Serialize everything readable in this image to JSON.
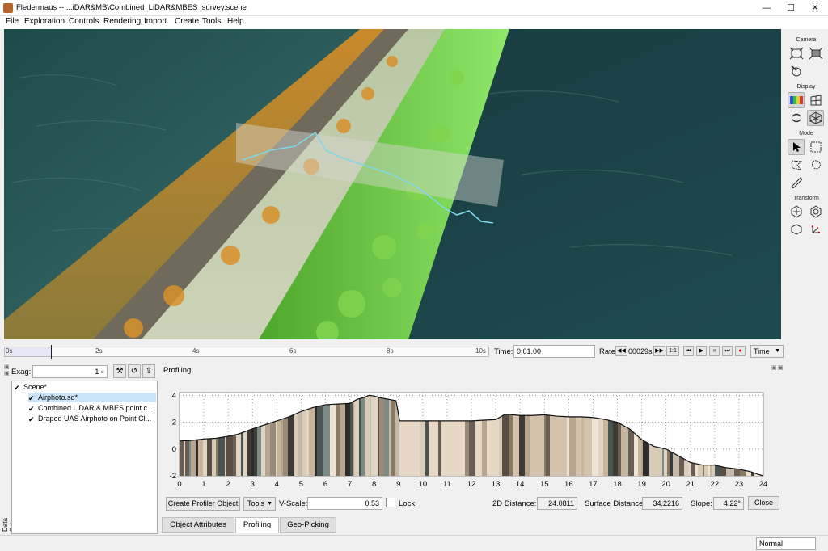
{
  "window": {
    "title": "Fledermaus -- ...iDAR&MB\\Combined_LiDAR&MBES_survey.scene",
    "minimize": "—",
    "maximize": "☐",
    "close": "✕"
  },
  "menu": [
    "File",
    "Exploration",
    "Controls",
    "Rendering",
    "Import",
    "Create",
    "Tools",
    "Help"
  ],
  "toolbar": {
    "camera_header": "Camera",
    "display_header": "Display",
    "mode_header": "Mode",
    "transform_header": "Transform"
  },
  "timeline": {
    "ticks": [
      "0s",
      "2s",
      "4s",
      "6s",
      "8s",
      "10s"
    ],
    "time_label": "Time:",
    "time_value": "0:01.00",
    "rate_label": "Rate:",
    "rate_value": "00029s",
    "ratio_label": "1:1",
    "mode_value": "Time",
    "progress": 0.095
  },
  "sidepanel": {
    "exag_label": "Exag:",
    "exag_value": "1",
    "data_sets_label": "Data Sets",
    "tree": [
      {
        "label": "Scene*",
        "checked": "✔",
        "indent": 0
      },
      {
        "label": "Airphoto.sd*",
        "checked": "✔",
        "indent": 1,
        "selected": true
      },
      {
        "label": "Combined LiDAR & MBES point c...",
        "checked": "✔",
        "indent": 1
      },
      {
        "label": "Draped UAS Airphoto on Point Cl...",
        "checked": "✔",
        "indent": 1
      }
    ]
  },
  "profiling": {
    "title": "Profiling",
    "create_button": "Create Profiler Object",
    "tools_button": "Tools",
    "vscale_label": "V-Scale:",
    "vscale_value": "0.53",
    "lock_label": "Lock",
    "dist2d_label": "2D Distance:",
    "dist2d_value": "24.0811",
    "surface_label": "Surface Distance:",
    "surface_value": "34.2216",
    "slope_label": "Slope:",
    "slope_value": "4.22°",
    "close_button": "Close"
  },
  "tabs": [
    "Object Attributes",
    "Profiling",
    "Geo-Picking"
  ],
  "active_tab": "Profiling",
  "status": {
    "mode_value": "Normal"
  },
  "chart_data": {
    "type": "area",
    "x_ticks": [
      0,
      1,
      2,
      3,
      4,
      5,
      6,
      7,
      8,
      9,
      10,
      11,
      12,
      13,
      14,
      15,
      16,
      17,
      18,
      19,
      20,
      21,
      22,
      23,
      24
    ],
    "y_ticks": [
      4,
      2,
      0,
      -2
    ],
    "xlim": [
      0,
      24
    ],
    "ylim": [
      -2,
      4.2
    ],
    "grid": true,
    "x": [
      0,
      0.5,
      1,
      1.5,
      2,
      2.4,
      3,
      3.5,
      4,
      4.5,
      5,
      5.5,
      6,
      6.5,
      7,
      7.3,
      7.6,
      7.8,
      8,
      8.3,
      8.6,
      8.9,
      9.05,
      9.3,
      10,
      11,
      12,
      13,
      13.4,
      14,
      14.5,
      15,
      15.5,
      16,
      16.5,
      17,
      17.5,
      18,
      18.5,
      19,
      19.5,
      20,
      20.5,
      21,
      21.5,
      22,
      22.5,
      23,
      23.5,
      23.8,
      24
    ],
    "y": [
      0.6,
      0.65,
      0.75,
      0.8,
      0.95,
      1.1,
      1.5,
      1.8,
      2.1,
      2.4,
      2.8,
      3.1,
      3.3,
      3.35,
      3.4,
      3.7,
      3.85,
      4.0,
      3.95,
      3.8,
      3.7,
      3.6,
      2.1,
      2.1,
      2.1,
      2.1,
      2.1,
      2.2,
      2.6,
      2.5,
      2.5,
      2.55,
      2.45,
      2.4,
      2.4,
      2.35,
      2.2,
      2.0,
      1.5,
      0.7,
      0.2,
      0.0,
      -0.5,
      -1.0,
      -1.2,
      -1.2,
      -1.4,
      -1.5,
      -1.7,
      -1.9,
      -2.0
    ]
  }
}
